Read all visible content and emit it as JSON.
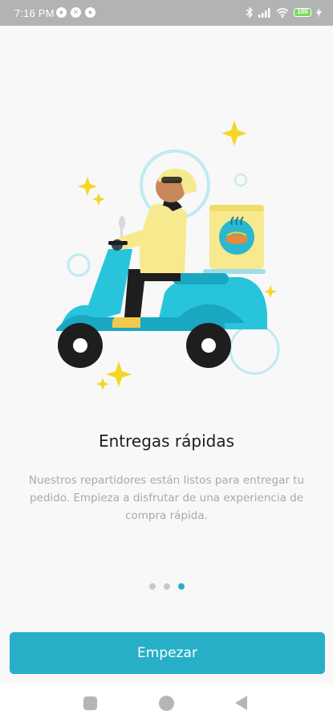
{
  "status_bar": {
    "time": "7:16 PM",
    "battery_level": "100",
    "left_icons": [
      "notification-icon",
      "missed-call-icon",
      "app-notification-icon"
    ],
    "right_icons": [
      "bluetooth-icon",
      "signal-icon",
      "wifi-icon",
      "battery-icon",
      "charging-icon"
    ]
  },
  "onboarding": {
    "illustration": "delivery-scooter-illustration",
    "title": "Entregas rápidas",
    "description": "Nuestros repartidores están listos para entregar tu pedido. Empieza a disfrutar de una experiencia de compra rápida.",
    "page_count": 3,
    "active_page": 3
  },
  "actions": {
    "start_label": "Empezar"
  },
  "nav_bar": {
    "icons": [
      "recents-square-icon",
      "home-circle-icon",
      "back-triangle-icon"
    ]
  },
  "colors": {
    "accent": "#27afc8",
    "scooter": "#28c4dc",
    "rider_shirt": "#f7e98e",
    "sparkle": "#f5d623",
    "status_bar": "#b3b3b3"
  }
}
